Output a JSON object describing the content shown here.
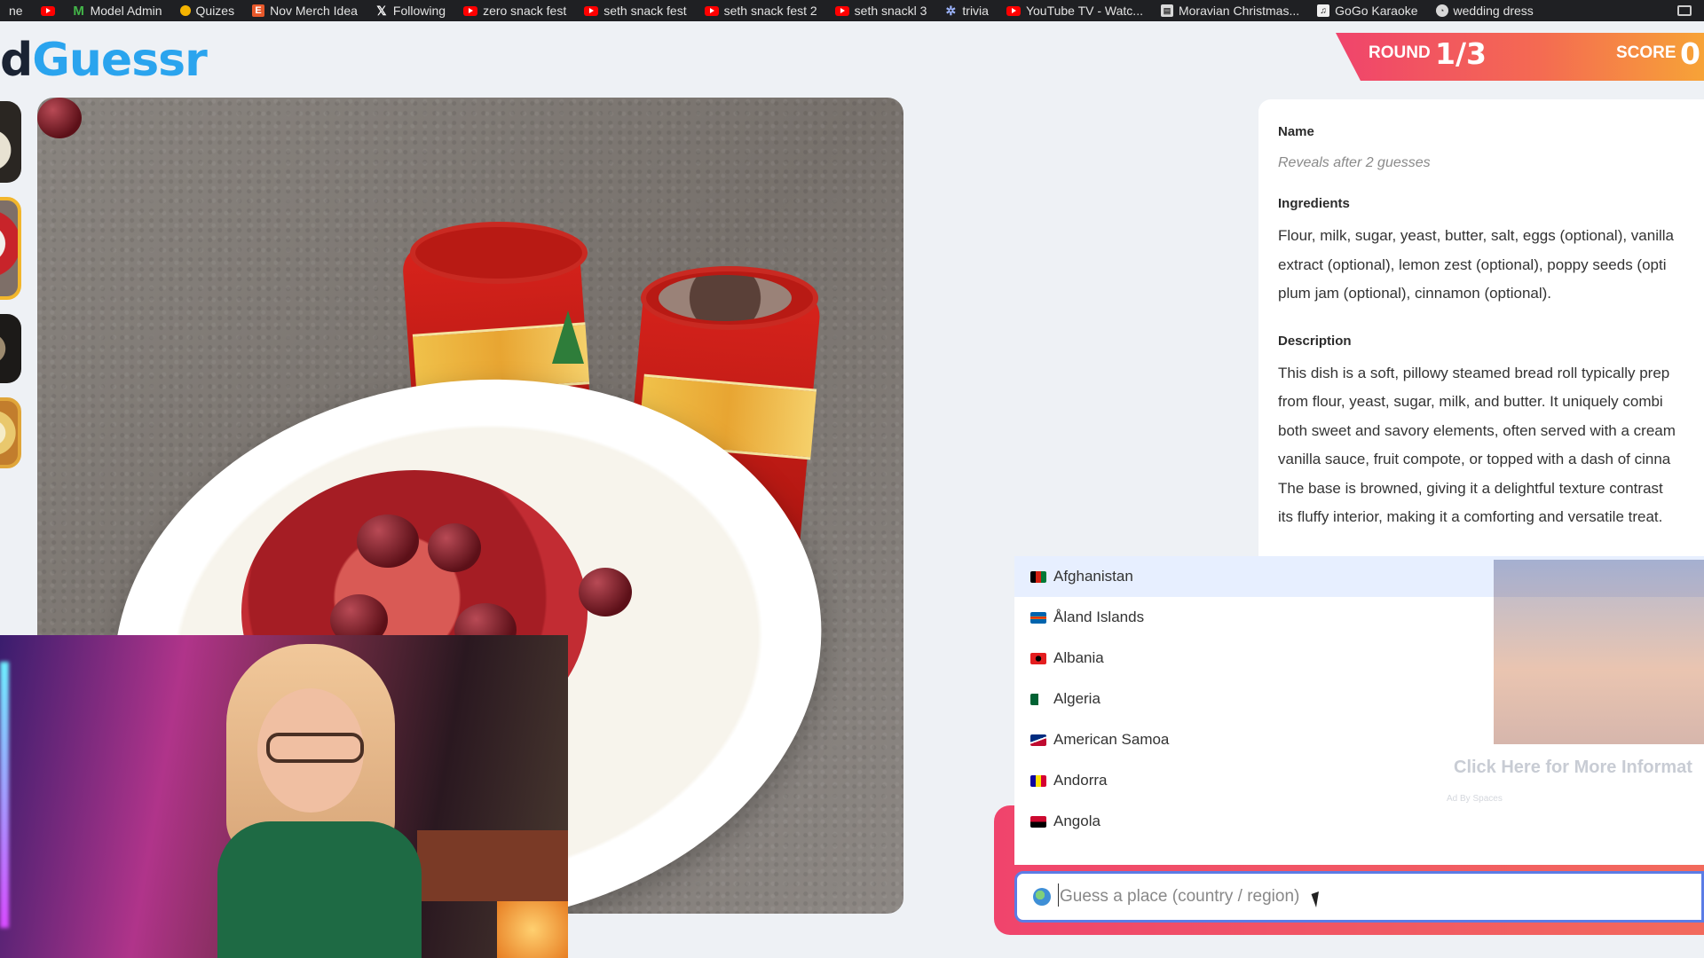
{
  "bookmarks": [
    {
      "label": "ne",
      "icon": "none"
    },
    {
      "label": "",
      "icon": "youtube-icon"
    },
    {
      "label": "Model Admin",
      "icon": "m-icon"
    },
    {
      "label": "Quizes",
      "icon": "bulb-icon"
    },
    {
      "label": "Nov Merch Idea",
      "icon": "e-icon"
    },
    {
      "label": "Following",
      "icon": "x-icon"
    },
    {
      "label": "zero snack fest",
      "icon": "youtube-icon"
    },
    {
      "label": "seth snack fest",
      "icon": "youtube-icon"
    },
    {
      "label": "seth snack fest 2",
      "icon": "youtube-icon"
    },
    {
      "label": "seth snackl 3",
      "icon": "youtube-icon"
    },
    {
      "label": "trivia",
      "icon": "star-icon"
    },
    {
      "label": "YouTube TV - Watc...",
      "icon": "youtube-icon"
    },
    {
      "label": "Moravian Christmas...",
      "icon": "doc-icon"
    },
    {
      "label": "GoGo Karaoke",
      "icon": "gogo-icon"
    },
    {
      "label": "wedding dress",
      "icon": "wd-icon"
    }
  ],
  "logo": {
    "part1": "d",
    "part2": "Guessr"
  },
  "header": {
    "round_label": "ROUND",
    "round_value": "1/3",
    "score_label": "SCORE",
    "score_value": "0"
  },
  "info": {
    "name_label": "Name",
    "name_value": "Reveals after 2 guesses",
    "ingredients_label": "Ingredients",
    "ingredients_lines": [
      "Flour, milk, sugar, yeast, butter, salt, eggs (optional), vanilla",
      "extract (optional), lemon zest (optional), poppy seeds (opti",
      "plum jam (optional), cinnamon (optional)."
    ],
    "description_label": "Description",
    "description_lines": [
      "This dish is a soft, pillowy steamed bread roll typically prep",
      "from flour, yeast, sugar, milk, and butter. It uniquely combi",
      "both sweet and savory elements, often served with a cream",
      "vanilla sauce, fruit compote, or topped with a dash of cinna",
      "The base is browned, giving it a delightful texture contrast",
      "its fluffy interior, making it a comforting and versatile treat."
    ]
  },
  "dropdown": {
    "items": [
      {
        "label": "Afghanistan",
        "flag_colors": [
          "#000000",
          "#d32011",
          "#007a36"
        ],
        "active": true
      },
      {
        "label": "Åland Islands",
        "flag_colors": [
          "#0064ad",
          "#ffd300",
          "#da0e15"
        ],
        "active": false
      },
      {
        "label": "Albania",
        "flag_colors": [
          "#e41e20",
          "#e41e20",
          "#000000"
        ],
        "active": false
      },
      {
        "label": "Algeria",
        "flag_colors": [
          "#006233",
          "#ffffff",
          "#d21034"
        ],
        "active": false
      },
      {
        "label": "American Samoa",
        "flag_colors": [
          "#002b7f",
          "#ffffff",
          "#bf0a30"
        ],
        "active": false
      },
      {
        "label": "Andorra",
        "flag_colors": [
          "#10069f",
          "#fedf00",
          "#d50032"
        ],
        "active": false
      },
      {
        "label": "Angola",
        "flag_colors": [
          "#cc092f",
          "#000000",
          "#ffcb00"
        ],
        "active": false
      }
    ]
  },
  "ad": {
    "headline": "Click Here for More Informat",
    "sub": "Ad By Spaces"
  },
  "guess": {
    "placeholder": "Guess a place (country / region)",
    "value": ""
  },
  "colors": {
    "accent_blue": "#2aa4ee",
    "header_gradient_start": "#f0446c",
    "header_gradient_end": "#f7a337",
    "input_border": "#5b7ce6"
  }
}
